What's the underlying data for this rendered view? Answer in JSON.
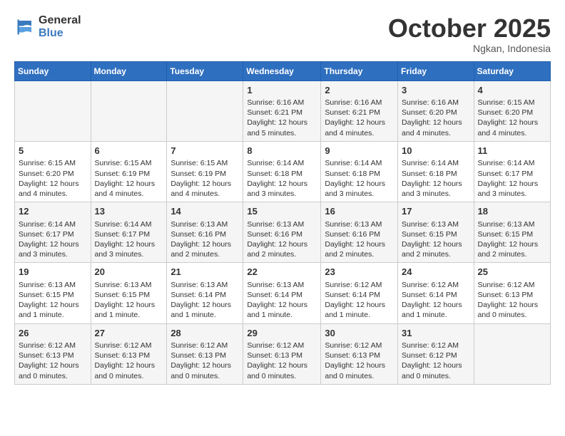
{
  "logo": {
    "line1": "General",
    "line2": "Blue"
  },
  "title": "October 2025",
  "location": "Ngkan, Indonesia",
  "days_header": [
    "Sunday",
    "Monday",
    "Tuesday",
    "Wednesday",
    "Thursday",
    "Friday",
    "Saturday"
  ],
  "weeks": [
    [
      {
        "num": "",
        "info": ""
      },
      {
        "num": "",
        "info": ""
      },
      {
        "num": "",
        "info": ""
      },
      {
        "num": "1",
        "info": "Sunrise: 6:16 AM\nSunset: 6:21 PM\nDaylight: 12 hours\nand 5 minutes."
      },
      {
        "num": "2",
        "info": "Sunrise: 6:16 AM\nSunset: 6:21 PM\nDaylight: 12 hours\nand 4 minutes."
      },
      {
        "num": "3",
        "info": "Sunrise: 6:16 AM\nSunset: 6:20 PM\nDaylight: 12 hours\nand 4 minutes."
      },
      {
        "num": "4",
        "info": "Sunrise: 6:15 AM\nSunset: 6:20 PM\nDaylight: 12 hours\nand 4 minutes."
      }
    ],
    [
      {
        "num": "5",
        "info": "Sunrise: 6:15 AM\nSunset: 6:20 PM\nDaylight: 12 hours\nand 4 minutes."
      },
      {
        "num": "6",
        "info": "Sunrise: 6:15 AM\nSunset: 6:19 PM\nDaylight: 12 hours\nand 4 minutes."
      },
      {
        "num": "7",
        "info": "Sunrise: 6:15 AM\nSunset: 6:19 PM\nDaylight: 12 hours\nand 4 minutes."
      },
      {
        "num": "8",
        "info": "Sunrise: 6:14 AM\nSunset: 6:18 PM\nDaylight: 12 hours\nand 3 minutes."
      },
      {
        "num": "9",
        "info": "Sunrise: 6:14 AM\nSunset: 6:18 PM\nDaylight: 12 hours\nand 3 minutes."
      },
      {
        "num": "10",
        "info": "Sunrise: 6:14 AM\nSunset: 6:18 PM\nDaylight: 12 hours\nand 3 minutes."
      },
      {
        "num": "11",
        "info": "Sunrise: 6:14 AM\nSunset: 6:17 PM\nDaylight: 12 hours\nand 3 minutes."
      }
    ],
    [
      {
        "num": "12",
        "info": "Sunrise: 6:14 AM\nSunset: 6:17 PM\nDaylight: 12 hours\nand 3 minutes."
      },
      {
        "num": "13",
        "info": "Sunrise: 6:14 AM\nSunset: 6:17 PM\nDaylight: 12 hours\nand 3 minutes."
      },
      {
        "num": "14",
        "info": "Sunrise: 6:13 AM\nSunset: 6:16 PM\nDaylight: 12 hours\nand 2 minutes."
      },
      {
        "num": "15",
        "info": "Sunrise: 6:13 AM\nSunset: 6:16 PM\nDaylight: 12 hours\nand 2 minutes."
      },
      {
        "num": "16",
        "info": "Sunrise: 6:13 AM\nSunset: 6:16 PM\nDaylight: 12 hours\nand 2 minutes."
      },
      {
        "num": "17",
        "info": "Sunrise: 6:13 AM\nSunset: 6:15 PM\nDaylight: 12 hours\nand 2 minutes."
      },
      {
        "num": "18",
        "info": "Sunrise: 6:13 AM\nSunset: 6:15 PM\nDaylight: 12 hours\nand 2 minutes."
      }
    ],
    [
      {
        "num": "19",
        "info": "Sunrise: 6:13 AM\nSunset: 6:15 PM\nDaylight: 12 hours\nand 1 minute."
      },
      {
        "num": "20",
        "info": "Sunrise: 6:13 AM\nSunset: 6:15 PM\nDaylight: 12 hours\nand 1 minute."
      },
      {
        "num": "21",
        "info": "Sunrise: 6:13 AM\nSunset: 6:14 PM\nDaylight: 12 hours\nand 1 minute."
      },
      {
        "num": "22",
        "info": "Sunrise: 6:13 AM\nSunset: 6:14 PM\nDaylight: 12 hours\nand 1 minute."
      },
      {
        "num": "23",
        "info": "Sunrise: 6:12 AM\nSunset: 6:14 PM\nDaylight: 12 hours\nand 1 minute."
      },
      {
        "num": "24",
        "info": "Sunrise: 6:12 AM\nSunset: 6:14 PM\nDaylight: 12 hours\nand 1 minute."
      },
      {
        "num": "25",
        "info": "Sunrise: 6:12 AM\nSunset: 6:13 PM\nDaylight: 12 hours\nand 0 minutes."
      }
    ],
    [
      {
        "num": "26",
        "info": "Sunrise: 6:12 AM\nSunset: 6:13 PM\nDaylight: 12 hours\nand 0 minutes."
      },
      {
        "num": "27",
        "info": "Sunrise: 6:12 AM\nSunset: 6:13 PM\nDaylight: 12 hours\nand 0 minutes."
      },
      {
        "num": "28",
        "info": "Sunrise: 6:12 AM\nSunset: 6:13 PM\nDaylight: 12 hours\nand 0 minutes."
      },
      {
        "num": "29",
        "info": "Sunrise: 6:12 AM\nSunset: 6:13 PM\nDaylight: 12 hours\nand 0 minutes."
      },
      {
        "num": "30",
        "info": "Sunrise: 6:12 AM\nSunset: 6:13 PM\nDaylight: 12 hours\nand 0 minutes."
      },
      {
        "num": "31",
        "info": "Sunrise: 6:12 AM\nSunset: 6:12 PM\nDaylight: 12 hours\nand 0 minutes."
      },
      {
        "num": "",
        "info": ""
      }
    ]
  ]
}
